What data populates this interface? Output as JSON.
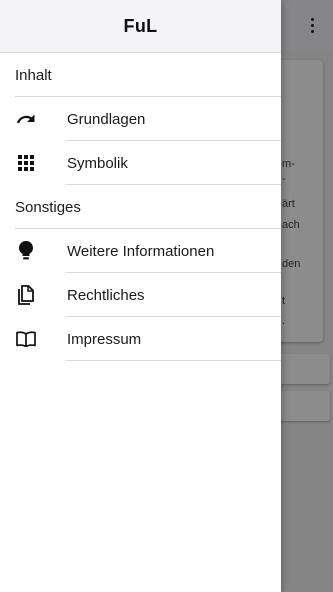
{
  "drawer": {
    "title": "FuL",
    "sections": [
      {
        "header": "Inhalt",
        "items": [
          {
            "label": "Grundlagen",
            "icon": "redo-arrow-icon"
          },
          {
            "label": "Symbolik",
            "icon": "grid-dots-icon"
          }
        ]
      },
      {
        "header": "Sonstiges",
        "items": [
          {
            "label": "Weitere Informationen",
            "icon": "lightbulb-icon"
          },
          {
            "label": "Rechtliches",
            "icon": "documents-icon"
          },
          {
            "label": "Impressum",
            "icon": "book-open-icon"
          }
        ]
      }
    ]
  },
  "background": {
    "snippets": [
      "m-",
      "-",
      "ärt",
      "ach",
      "den",
      "t",
      "."
    ]
  }
}
